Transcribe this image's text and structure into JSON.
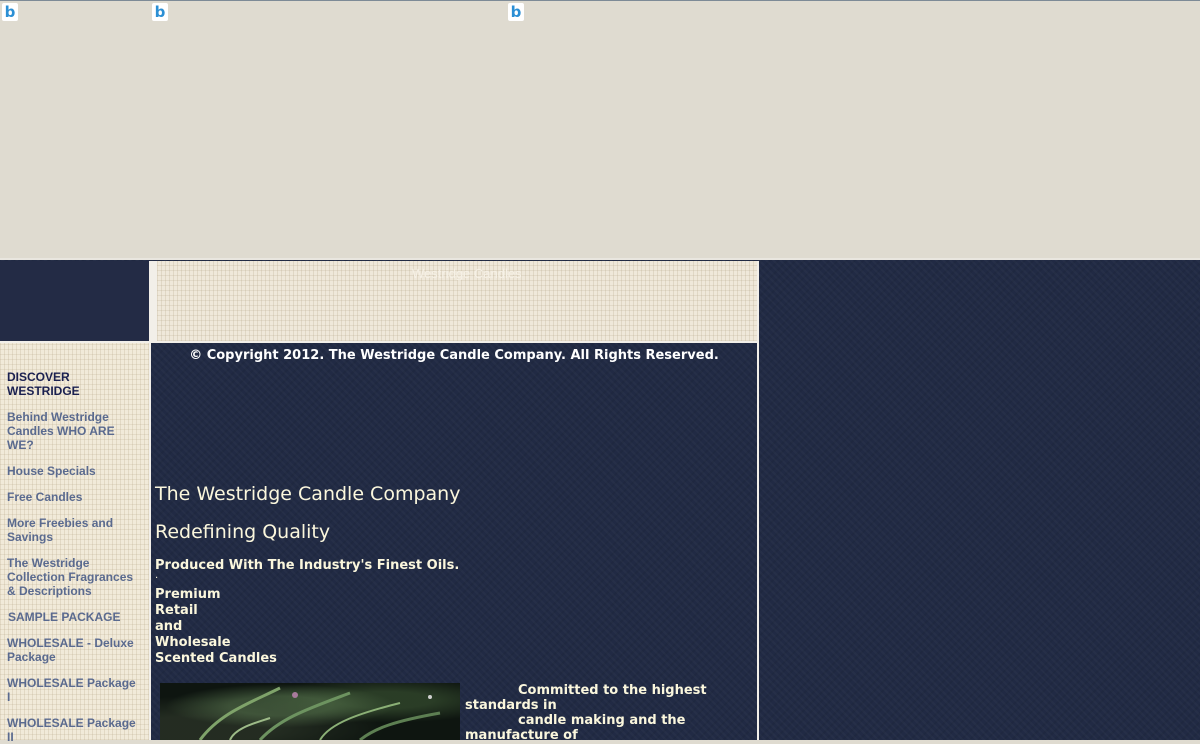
{
  "top_icons": [
    "b",
    "b",
    "b"
  ],
  "banner": {
    "text": "Westridge Candles"
  },
  "sidebar": {
    "heading": "DISCOVER WESTRIDGE",
    "links": [
      "Behind Westridge Candles WHO ARE WE?",
      "House Specials",
      "Free Candles",
      "More Freebies and Savings",
      "The Westridge Collection Fragrances & Descriptions",
      "SAMPLE PACKAGE",
      "WHOLESALE - Deluxe Package",
      "WHOLESALE Package I",
      "WHOLESALE Package II"
    ]
  },
  "main": {
    "copyright": "© Copyright 2012. The Westridge Candle Company. All Rights Reserved.",
    "title": "The Westridge Candle Company",
    "subtitle": "Redefining Quality",
    "produced": "Produced With The Industry's Finest Oils.",
    "dot": ".",
    "stack": [
      "Premium",
      "Retail",
      "and",
      "Wholesale",
      "Scented Candles"
    ],
    "commit_lines": [
      "Committed to the highest",
      "standards in",
      "candle making and the",
      "manufacture of"
    ]
  },
  "colors": {
    "navy": "#212a44",
    "cream": "#f1ead9",
    "page_gray": "#dfdbd0",
    "nav_link": "#5a6a8f",
    "heading_dark": "#1a2050"
  }
}
